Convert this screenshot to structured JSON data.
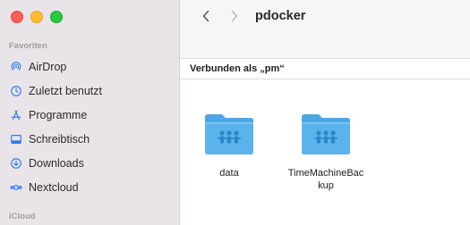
{
  "sidebar": {
    "favorites_title": "Favoriten",
    "items": [
      {
        "label": "AirDrop",
        "icon": "airdrop-icon"
      },
      {
        "label": "Zuletzt benutzt",
        "icon": "clock-icon"
      },
      {
        "label": "Programme",
        "icon": "applications-icon"
      },
      {
        "label": "Schreibtisch",
        "icon": "desktop-icon"
      },
      {
        "label": "Downloads",
        "icon": "download-icon"
      },
      {
        "label": "Nextcloud",
        "icon": "nextcloud-icon"
      }
    ],
    "icloud_title": "iCloud"
  },
  "toolbar": {
    "title": "pdocker"
  },
  "connection": {
    "text": "Verbunden als „pm“"
  },
  "files": [
    {
      "name": "data",
      "icon": "shared-folder-icon"
    },
    {
      "name": "TimeMachineBackup",
      "name_line1": "TimeMachineBac",
      "name_line2": "kup",
      "icon": "shared-folder-icon"
    }
  ],
  "colors": {
    "accent": "#2f7cf6",
    "folder": "#5ab3ea",
    "sidebar_bg": "#e9e4e8"
  }
}
